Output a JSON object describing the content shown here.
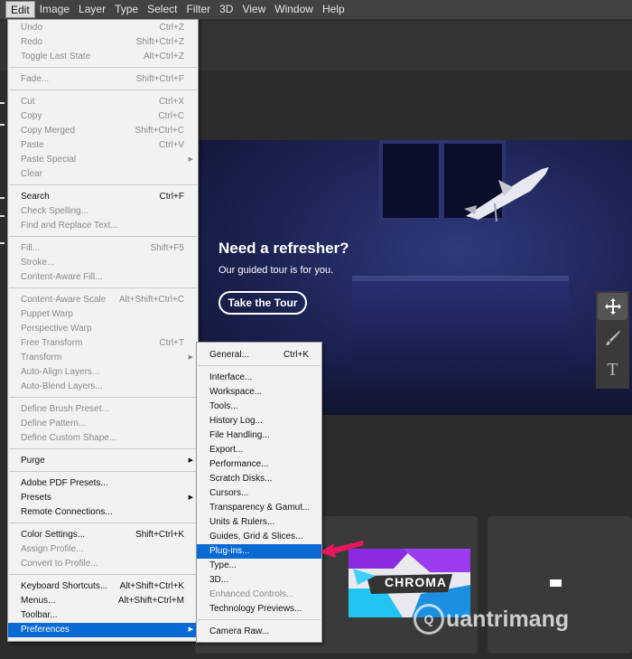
{
  "menubar": {
    "items": [
      {
        "label": "Edit",
        "active": true
      },
      {
        "label": "Image"
      },
      {
        "label": "Layer"
      },
      {
        "label": "Type"
      },
      {
        "label": "Select"
      },
      {
        "label": "Filter"
      },
      {
        "label": "3D"
      },
      {
        "label": "View"
      },
      {
        "label": "Window"
      },
      {
        "label": "Help"
      }
    ]
  },
  "edit_menu": {
    "items": [
      {
        "label": "Undo",
        "shortcut": "Ctrl+Z",
        "disabled": true
      },
      {
        "label": "Redo",
        "shortcut": "Shift+Ctrl+Z",
        "disabled": true
      },
      {
        "label": "Toggle Last State",
        "shortcut": "Alt+Ctrl+Z",
        "disabled": true
      },
      {
        "separator": true
      },
      {
        "label": "Fade...",
        "shortcut": "Shift+Ctrl+F",
        "disabled": true
      },
      {
        "separator": true
      },
      {
        "label": "Cut",
        "shortcut": "Ctrl+X",
        "disabled": true
      },
      {
        "label": "Copy",
        "shortcut": "Ctrl+C",
        "disabled": true
      },
      {
        "label": "Copy Merged",
        "shortcut": "Shift+Ctrl+C",
        "disabled": true
      },
      {
        "label": "Paste",
        "shortcut": "Ctrl+V",
        "disabled": true
      },
      {
        "label": "Paste Special",
        "submenu": true,
        "disabled": true
      },
      {
        "label": "Clear",
        "disabled": true
      },
      {
        "separator": true
      },
      {
        "label": "Search",
        "shortcut": "Ctrl+F"
      },
      {
        "label": "Check Spelling...",
        "disabled": true
      },
      {
        "label": "Find and Replace Text...",
        "disabled": true
      },
      {
        "separator": true
      },
      {
        "label": "Fill...",
        "shortcut": "Shift+F5",
        "disabled": true
      },
      {
        "label": "Stroke...",
        "disabled": true
      },
      {
        "label": "Content-Aware Fill...",
        "disabled": true
      },
      {
        "separator": true
      },
      {
        "label": "Content-Aware Scale",
        "shortcut": "Alt+Shift+Ctrl+C",
        "disabled": true
      },
      {
        "label": "Puppet Warp",
        "disabled": true
      },
      {
        "label": "Perspective Warp",
        "disabled": true
      },
      {
        "label": "Free Transform",
        "shortcut": "Ctrl+T",
        "disabled": true
      },
      {
        "label": "Transform",
        "submenu": true,
        "disabled": true
      },
      {
        "label": "Auto-Align Layers...",
        "disabled": true
      },
      {
        "label": "Auto-Blend Layers...",
        "disabled": true
      },
      {
        "separator": true
      },
      {
        "label": "Define Brush Preset...",
        "disabled": true
      },
      {
        "label": "Define Pattern...",
        "disabled": true
      },
      {
        "label": "Define Custom Shape...",
        "disabled": true
      },
      {
        "separator": true
      },
      {
        "label": "Purge",
        "submenu": true
      },
      {
        "separator": true
      },
      {
        "label": "Adobe PDF Presets..."
      },
      {
        "label": "Presets",
        "submenu": true
      },
      {
        "label": "Remote Connections..."
      },
      {
        "separator": true
      },
      {
        "label": "Color Settings...",
        "shortcut": "Shift+Ctrl+K"
      },
      {
        "label": "Assign Profile...",
        "disabled": true
      },
      {
        "label": "Convert to Profile...",
        "disabled": true
      },
      {
        "separator": true
      },
      {
        "label": "Keyboard Shortcuts...",
        "shortcut": "Alt+Shift+Ctrl+K"
      },
      {
        "label": "Menus...",
        "shortcut": "Alt+Shift+Ctrl+M"
      },
      {
        "label": "Toolbar..."
      },
      {
        "label": "Preferences",
        "submenu": true,
        "highlighted": true
      }
    ]
  },
  "preferences_menu": {
    "items": [
      {
        "label": "General...",
        "shortcut": "Ctrl+K"
      },
      {
        "separator": true
      },
      {
        "label": "Interface..."
      },
      {
        "label": "Workspace..."
      },
      {
        "label": "Tools..."
      },
      {
        "label": "History Log..."
      },
      {
        "label": "File Handling..."
      },
      {
        "label": "Export..."
      },
      {
        "label": "Performance..."
      },
      {
        "label": "Scratch Disks..."
      },
      {
        "label": "Cursors..."
      },
      {
        "label": "Transparency & Gamut..."
      },
      {
        "label": "Units & Rulers..."
      },
      {
        "label": "Guides, Grid & Slices..."
      },
      {
        "label": "Plug-ins...",
        "highlighted": true
      },
      {
        "label": "Type..."
      },
      {
        "label": "3D..."
      },
      {
        "label": "Enhanced Controls...",
        "disabled": true
      },
      {
        "label": "Technology Previews..."
      },
      {
        "separator": true
      },
      {
        "label": "Camera Raw..."
      }
    ]
  },
  "hero": {
    "title": "Need a refresher?",
    "subtitle": "Our guided tour is for you.",
    "button": "Take the Tour"
  },
  "tools": {
    "icons": [
      "move-icon",
      "brush-icon",
      "type-icon"
    ],
    "type_glyph": "T"
  },
  "recent": {
    "chroma_title": "CHROMA"
  },
  "watermark": {
    "text": "uantrimang",
    "logo_glyph": "Q"
  },
  "colors": {
    "menu_highlight": "#0a6ad4",
    "annotation_arrow": "#e8175d",
    "chroma_purple": "#8a2be2",
    "chroma_cyan": "#22c4f2"
  }
}
